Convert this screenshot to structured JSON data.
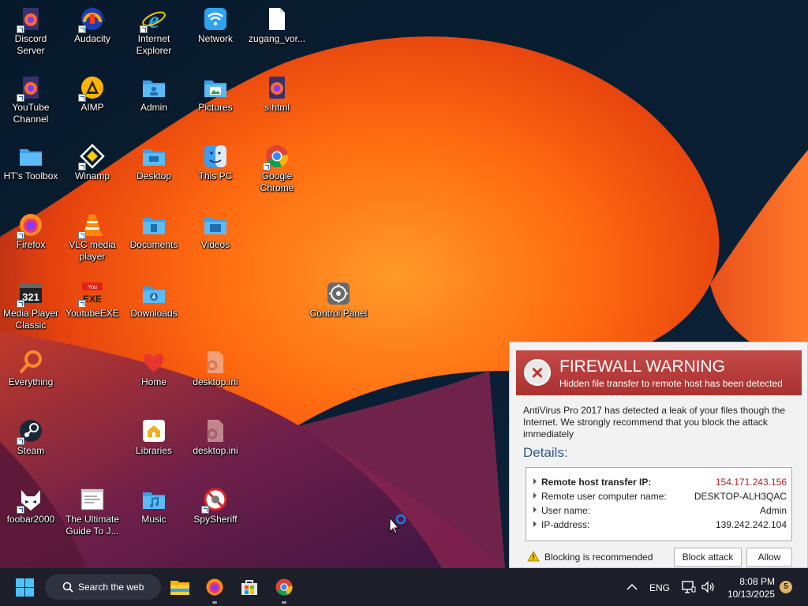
{
  "desktop": {
    "icons": [
      {
        "label": "Discord Server",
        "icon": "firefox-html-icon"
      },
      {
        "label": "Audacity",
        "icon": "audacity-icon"
      },
      {
        "label": "Internet Explorer",
        "icon": "internet-explorer-icon"
      },
      {
        "label": "Network",
        "icon": "network-icon"
      },
      {
        "label": "zugang_vor...",
        "icon": "file-icon"
      },
      {
        "label": "YouTube Channel",
        "icon": "firefox-html-icon"
      },
      {
        "label": "AIMP",
        "icon": "aimp-icon"
      },
      {
        "label": "Admin",
        "icon": "user-folder-icon"
      },
      {
        "label": "Pictures",
        "icon": "pictures-folder-icon"
      },
      {
        "label": "s.html",
        "icon": "firefox-html-icon"
      },
      {
        "label": "HT's Toolbox",
        "icon": "folder-icon"
      },
      {
        "label": "Winamp",
        "icon": "winamp-icon"
      },
      {
        "label": "Desktop",
        "icon": "desktop-folder-icon"
      },
      {
        "label": "This PC",
        "icon": "finder-icon"
      },
      {
        "label": "Google Chrome",
        "icon": "chrome-icon"
      },
      {
        "label": "Firefox",
        "icon": "firefox-icon"
      },
      {
        "label": "VLC media player",
        "icon": "vlc-icon"
      },
      {
        "label": "Documents",
        "icon": "documents-folder-icon"
      },
      {
        "label": "Videos",
        "icon": "videos-folder-icon"
      },
      {
        "label": "Media Player Classic",
        "icon": "media-player-classic-icon"
      },
      {
        "label": "YoutubeEXE",
        "icon": "youtube-exe-icon"
      },
      {
        "label": "Downloads",
        "icon": "downloads-folder-icon"
      },
      {
        "label": "Control Panel",
        "icon": "control-panel-icon"
      },
      {
        "label": "Everything",
        "icon": "everything-search-icon"
      },
      {
        "label": "Home",
        "icon": "heart-icon"
      },
      {
        "label": "desktop.ini",
        "icon": "settings-file-icon"
      },
      {
        "label": "Steam",
        "icon": "steam-icon"
      },
      {
        "label": "Libraries",
        "icon": "libraries-icon"
      },
      {
        "label": "desktop.ini",
        "icon": "settings-file-icon"
      },
      {
        "label": "foobar2000",
        "icon": "foobar-icon"
      },
      {
        "label": "The Ultimate Guide To J...",
        "icon": "document-window-icon"
      },
      {
        "label": "Music",
        "icon": "music-folder-icon"
      },
      {
        "label": "SpySheriff",
        "icon": "spysheriff-icon"
      }
    ]
  },
  "popup": {
    "title": "FIREWALL WARNING",
    "subtitle": "Hidden file transfer to remote host has been detected",
    "message": "AntiVirus Pro 2017 has detected a leak of your files though the Internet. We strongly recommend that you block the attack immediately",
    "details_heading": "Details:",
    "rows": [
      {
        "key": "Remote host transfer IP:",
        "value": "154.171.243.156"
      },
      {
        "key": "Remote user computer name:",
        "value": "DESKTOP-ALH3QAC"
      },
      {
        "key": "User name:",
        "value": "Admin"
      },
      {
        "key": "IP-address:",
        "value": "139.242.242.104"
      }
    ],
    "warning": "Blocking is recommended",
    "block_label": "Block attack",
    "allow_label": "Allow",
    "colors": {
      "banner": "#b43a38",
      "ip_value": "#b22222",
      "details": "#2c5a8a"
    }
  },
  "taskbar": {
    "search_label": "Search the web",
    "language": "ENG",
    "time": "8:08 PM",
    "date": "10/13/2025",
    "notification_count": "5"
  }
}
